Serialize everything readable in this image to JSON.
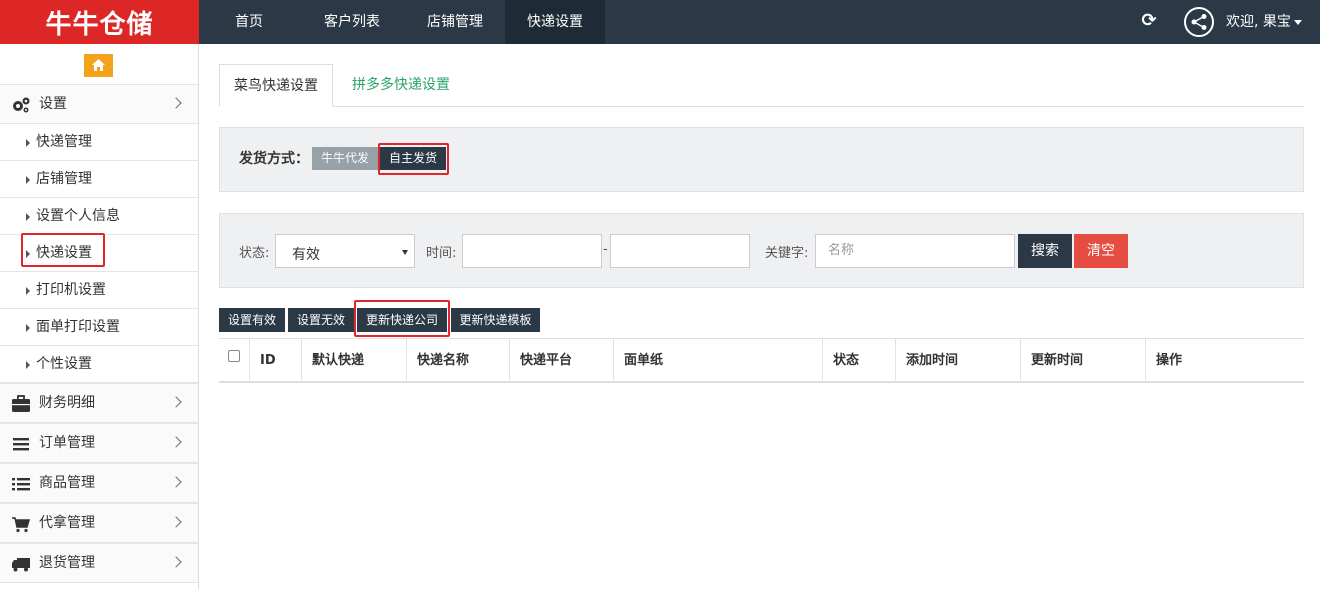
{
  "app": {
    "logo_text": "牛牛仓储"
  },
  "topnav": {
    "items": [
      "首页",
      "客户列表",
      "店铺管理",
      "快递设置"
    ],
    "active_index": 3,
    "welcome": "欢迎, 果宝"
  },
  "icons": {
    "home": "home-icon",
    "refresh": "refresh-icon",
    "user": "share-network-icon",
    "settings": "gears-icon",
    "finance": "briefcase-icon",
    "order": "bars-icon",
    "goods": "list-icon",
    "proxy": "cart-icon",
    "return": "truck-icon"
  },
  "sidebar": {
    "settings_label": "设置",
    "sub_items": [
      "快递管理",
      "店铺管理",
      "设置个人信息",
      "快递设置",
      "打印机设置",
      "面单打印设置",
      "个性设置"
    ],
    "groups": [
      "财务明细",
      "订单管理",
      "商品管理",
      "代拿管理",
      "退货管理"
    ]
  },
  "tabs": [
    "菜鸟快递设置",
    "拼多多快递设置"
  ],
  "shipping": {
    "label": "发货方式：",
    "options": [
      "牛牛代发",
      "自主发货"
    ]
  },
  "filter": {
    "status_label": "状态:",
    "status_value": "有效",
    "time_label": "时间:",
    "time_separator": "-",
    "keyword_label": "关键字:",
    "keyword_placeholder": "名称",
    "search_btn": "搜索",
    "clear_btn": "清空"
  },
  "actions": [
    "设置有效",
    "设置无效",
    "更新快递公司",
    "更新快递模板"
  ],
  "table": {
    "columns": [
      "ID",
      "默认快递",
      "快递名称",
      "快递平台",
      "面单纸",
      "状态",
      "添加时间",
      "更新时间",
      "操作"
    ]
  },
  "colors": {
    "topbar": "#2b3845",
    "logo_bg": "#dd2727",
    "home_btn": "#f3a21c",
    "dark_btn": "#2b3845",
    "gray_btn": "#96a1a8",
    "danger": "#e54d42",
    "highlight": "#e0262b",
    "tab_link": "#2aa36b"
  }
}
